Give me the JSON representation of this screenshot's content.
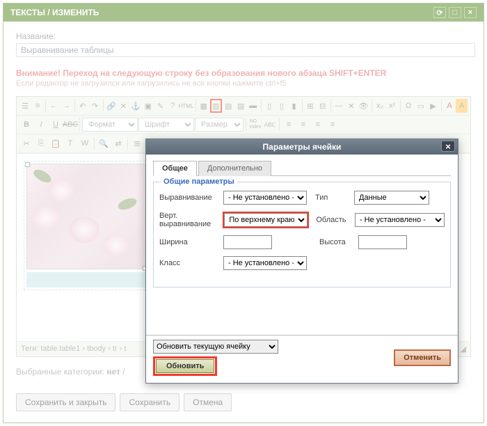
{
  "window": {
    "title": "ТЕКСТЫ / ИЗМЕНИТЬ"
  },
  "form": {
    "name_label": "Название:",
    "name_value": "Выравнивание таблицы",
    "warn_bold": "Внимание! Переход на следующую строку без образования нового абзаца SHIFT+ENTER",
    "warn_sub": "Если редактор не загрузился или загрузились не все кнопки нажмите ctrl+f5",
    "format_placeholder": "Формат",
    "font_placeholder": "Шрифт",
    "size_placeholder": "Размер",
    "path": "Теги: table.table1 › tbody › tr › t",
    "categories_label": "Выбранные категории:",
    "categories_value": "нет",
    "btn_save_close": "Сохранить и закрыть",
    "btn_save": "Сохранить",
    "btn_cancel2": "Отмена"
  },
  "dialog": {
    "title": "Параметры ячейки",
    "tab_general": "Общее",
    "tab_advanced": "Дополнительно",
    "legend": "Общие параметры",
    "align_label": "Выравнивание",
    "align_value": "- Не установлено -",
    "type_label": "Тип",
    "type_value": "Данные",
    "valign_label": "Верт. выравнивание",
    "valign_value": "По верхнему краю",
    "area_label": "Область",
    "area_value": "- Не установлено -",
    "width_label": "Ширина",
    "width_value": "",
    "height_label": "Высота",
    "height_value": "",
    "class_label": "Класс",
    "class_value": "- Не установлено -",
    "scope_value": "Обновить текущую ячейку",
    "btn_update": "Обновить",
    "btn_cancel": "Отменить"
  }
}
